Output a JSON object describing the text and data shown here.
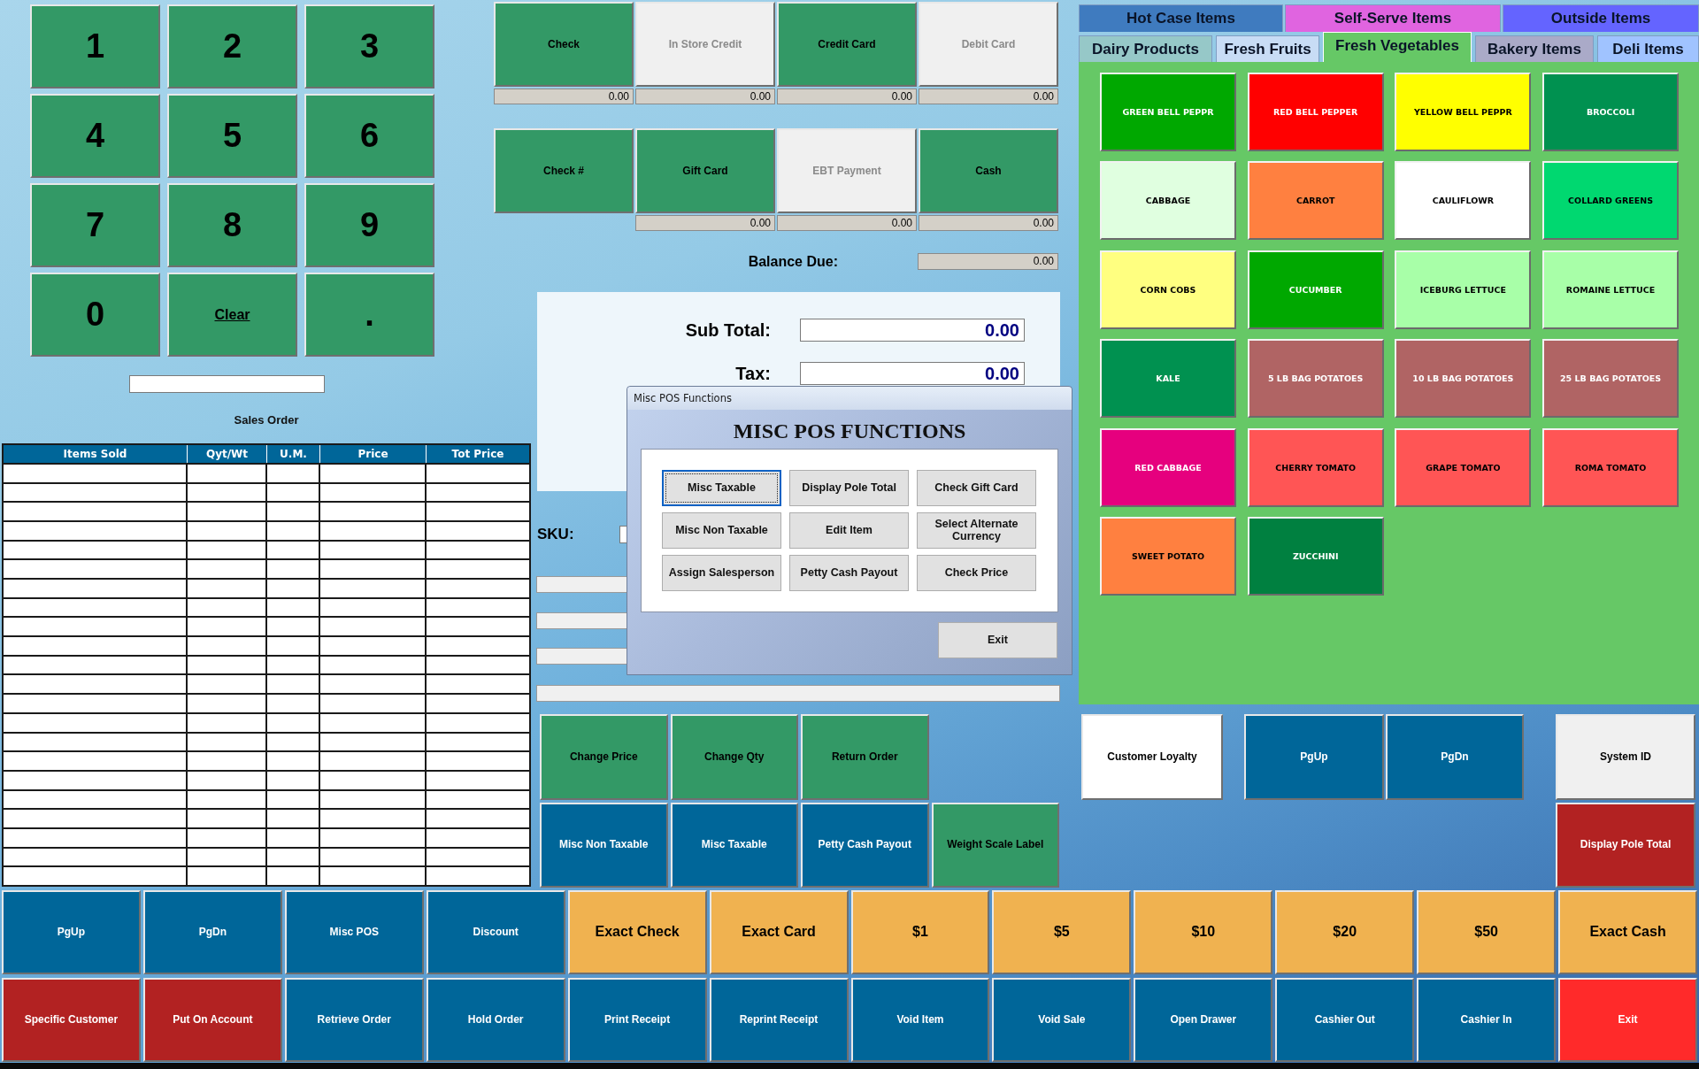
{
  "keypad": {
    "keys": [
      {
        "label": "1",
        "kind": "digit"
      },
      {
        "label": "2",
        "kind": "digit"
      },
      {
        "label": "3",
        "kind": "digit"
      },
      {
        "label": "4",
        "kind": "digit"
      },
      {
        "label": "5",
        "kind": "digit"
      },
      {
        "label": "6",
        "kind": "digit"
      },
      {
        "label": "7",
        "kind": "digit"
      },
      {
        "label": "8",
        "kind": "digit"
      },
      {
        "label": "9",
        "kind": "digit"
      },
      {
        "label": "0",
        "kind": "digit"
      },
      {
        "label": "Clear",
        "kind": "command"
      },
      {
        "label": ".",
        "kind": "digit"
      }
    ]
  },
  "payment_methods": [
    {
      "label": "Check",
      "disabled": false,
      "amount": "0.00"
    },
    {
      "label": "In Store Credit",
      "disabled": true,
      "amount": "0.00"
    },
    {
      "label": "Credit Card",
      "disabled": false,
      "amount": "0.00"
    },
    {
      "label": "Debit Card",
      "disabled": true,
      "amount": "0.00"
    },
    {
      "label": "Check #",
      "disabled": false
    },
    {
      "label": "Gift Card",
      "disabled": false,
      "amount": "0.00"
    },
    {
      "label": "EBT Payment",
      "disabled": true,
      "amount": "0.00"
    },
    {
      "label": "Cash",
      "disabled": false,
      "amount": "0.00"
    }
  ],
  "balance_due": {
    "label": "Balance Due:",
    "value": "0.00"
  },
  "category_tabs": {
    "rows": [
      {
        "tabs": [
          {
            "label": "Hot Case Items",
            "color": "#3f7bbf",
            "selected": false
          },
          {
            "label": "Self-Serve Items",
            "color": "#e064e0",
            "selected": false
          },
          {
            "label": "Outside Items",
            "color": "#6464ff",
            "selected": false
          }
        ]
      },
      {
        "tabs": [
          {
            "label": "Dairy Products",
            "color": "#96c8c8",
            "selected": false
          },
          {
            "label": "Fresh Fruits",
            "color": "#c8dcf5",
            "selected": false
          },
          {
            "label": "Fresh Vegetables",
            "color": "#66c866",
            "selected": true
          },
          {
            "label": "Bakery Items",
            "color": "#aaaac8",
            "selected": false
          },
          {
            "label": "Deli Items",
            "color": "#a0c3ff",
            "selected": false
          }
        ]
      }
    ]
  },
  "products": [
    {
      "label": "GREEN BELL PEPPR",
      "color": "#00a800"
    },
    {
      "label": "RED BELL PEPPER",
      "color": "#ff0000"
    },
    {
      "label": "YELLOW BELL PEPPR",
      "color": "#ffff00"
    },
    {
      "label": "BROCCOLI",
      "color": "#009150"
    },
    {
      "label": "CABBAGE",
      "color": "#e0ffe0"
    },
    {
      "label": "CARROT",
      "color": "#ff8040"
    },
    {
      "label": "CAULIFLOWR",
      "color": "#ffffff"
    },
    {
      "label": "COLLARD GREENS",
      "color": "#00d870"
    },
    {
      "label": "CORN COBS",
      "color": "#ffff80"
    },
    {
      "label": "CUCUMBER",
      "color": "#00a800"
    },
    {
      "label": "ICEBURG LETTUCE",
      "color": "#a8ffa8"
    },
    {
      "label": "ROMAINE LETTUCE",
      "color": "#a8ffa8"
    },
    {
      "label": "KALE",
      "color": "#009150"
    },
    {
      "label": "5 LB BAG POTATOES",
      "color": "#b06464"
    },
    {
      "label": "10 LB BAG POTATOES",
      "color": "#b06464"
    },
    {
      "label": "25 LB BAG POTATOES",
      "color": "#b06464"
    },
    {
      "label": "RED CABBAGE",
      "color": "#e6007e"
    },
    {
      "label": "CHERRY TOMATO",
      "color": "#ff5555"
    },
    {
      "label": "GRAPE TOMATO",
      "color": "#ff5555"
    },
    {
      "label": "ROMA TOMATO",
      "color": "#ff5555"
    },
    {
      "label": "SWEET POTATO",
      "color": "#ff8040"
    },
    {
      "label": "ZUCCHINI",
      "color": "#008040"
    }
  ],
  "totals": [
    {
      "label": "Sub Total:",
      "value": "0.00"
    },
    {
      "label": "Tax:",
      "value": "0.00"
    }
  ],
  "sales_order": {
    "title": "Sales Order",
    "columns": [
      "Items Sold",
      "Qyt/Wt",
      "U.M.",
      "Price",
      "Tot Price"
    ]
  },
  "sku": {
    "label": "SKU:"
  },
  "dialog": {
    "title": "Misc POS Functions",
    "heading": "MISC POS FUNCTIONS",
    "buttons": [
      {
        "label": "Misc Taxable",
        "focused": true
      },
      {
        "label": "Display Pole Total",
        "focused": false
      },
      {
        "label": "Check Gift Card",
        "focused": false
      },
      {
        "label": "Misc Non Taxable",
        "focused": false
      },
      {
        "label": "Edit Item",
        "focused": false
      },
      {
        "label": "Select Alternate Currency",
        "focused": false
      },
      {
        "label": "Assign Salesperson",
        "focused": false
      },
      {
        "label": "Petty Cash Payout",
        "focused": false
      },
      {
        "label": "Check Price",
        "focused": false
      }
    ],
    "exit": {
      "label": "Exit"
    }
  },
  "item_actions": {
    "rows": [
      {
        "buttons": [
          {
            "label": "Change Price",
            "color": "#339966"
          },
          {
            "label": "Change Qty",
            "color": "#339966"
          },
          {
            "label": "Return Order",
            "color": "#339966"
          }
        ]
      },
      {
        "buttons": [
          {
            "label": "Misc Non Taxable",
            "color": "#006699"
          },
          {
            "label": "Misc Taxable",
            "color": "#006699"
          },
          {
            "label": "Petty Cash Payout",
            "color": "#006699"
          },
          {
            "label": "Weight Scale Label",
            "color": "#339966"
          }
        ]
      }
    ]
  },
  "side_buttons": {
    "rows": [
      {
        "buttons": [
          {
            "label": "Customer Loyalty",
            "color": "#ffffff"
          },
          {
            "label": "PgUp",
            "color": "#006699"
          },
          {
            "label": "PgDn",
            "color": "#006699"
          },
          {
            "label": "System ID",
            "color": "#f0f0f0"
          }
        ]
      },
      {
        "buttons": [
          {
            "label": "Display Pole Total",
            "color": "#b22222"
          }
        ]
      }
    ]
  },
  "register_buttons": {
    "rows": [
      {
        "buttons": [
          {
            "label": "PgUp",
            "color": "#006699",
            "kind": "function"
          },
          {
            "label": "PgDn",
            "color": "#006699",
            "kind": "function"
          },
          {
            "label": "Misc POS",
            "color": "#006699",
            "kind": "function"
          },
          {
            "label": "Discount",
            "color": "#006699",
            "kind": "function"
          },
          {
            "label": "Exact Check",
            "color": "#f0b250",
            "kind": "tender"
          },
          {
            "label": "Exact Card",
            "color": "#f0b250",
            "kind": "tender"
          },
          {
            "label": "$1",
            "color": "#f0b250",
            "kind": "tender"
          },
          {
            "label": "$5",
            "color": "#f0b250",
            "kind": "tender"
          },
          {
            "label": "$10",
            "color": "#f0b250",
            "kind": "tender"
          },
          {
            "label": "$20",
            "color": "#f0b250",
            "kind": "tender"
          },
          {
            "label": "$50",
            "color": "#f0b250",
            "kind": "tender"
          },
          {
            "label": "Exact Cash",
            "color": "#f0b250",
            "kind": "tender"
          }
        ]
      },
      {
        "buttons": [
          {
            "label": "Specific Customer",
            "color": "#b22222",
            "kind": "function"
          },
          {
            "label": "Put On Account",
            "color": "#b22222",
            "kind": "function"
          },
          {
            "label": "Retrieve Order",
            "color": "#006699",
            "kind": "function"
          },
          {
            "label": "Hold Order",
            "color": "#006699",
            "kind": "function"
          },
          {
            "label": "Print Receipt",
            "color": "#006699",
            "kind": "function"
          },
          {
            "label": "Reprint Receipt",
            "color": "#006699",
            "kind": "function"
          },
          {
            "label": "Void Item",
            "color": "#006699",
            "kind": "function"
          },
          {
            "label": "Void Sale",
            "color": "#006699",
            "kind": "function"
          },
          {
            "label": "Open Drawer",
            "color": "#006699",
            "kind": "function"
          },
          {
            "label": "Cashier Out",
            "color": "#006699",
            "kind": "function"
          },
          {
            "label": "Cashier In",
            "color": "#006699",
            "kind": "function"
          },
          {
            "label": "Exit",
            "color": "#ff2a2a",
            "kind": "function"
          }
        ]
      }
    ]
  }
}
